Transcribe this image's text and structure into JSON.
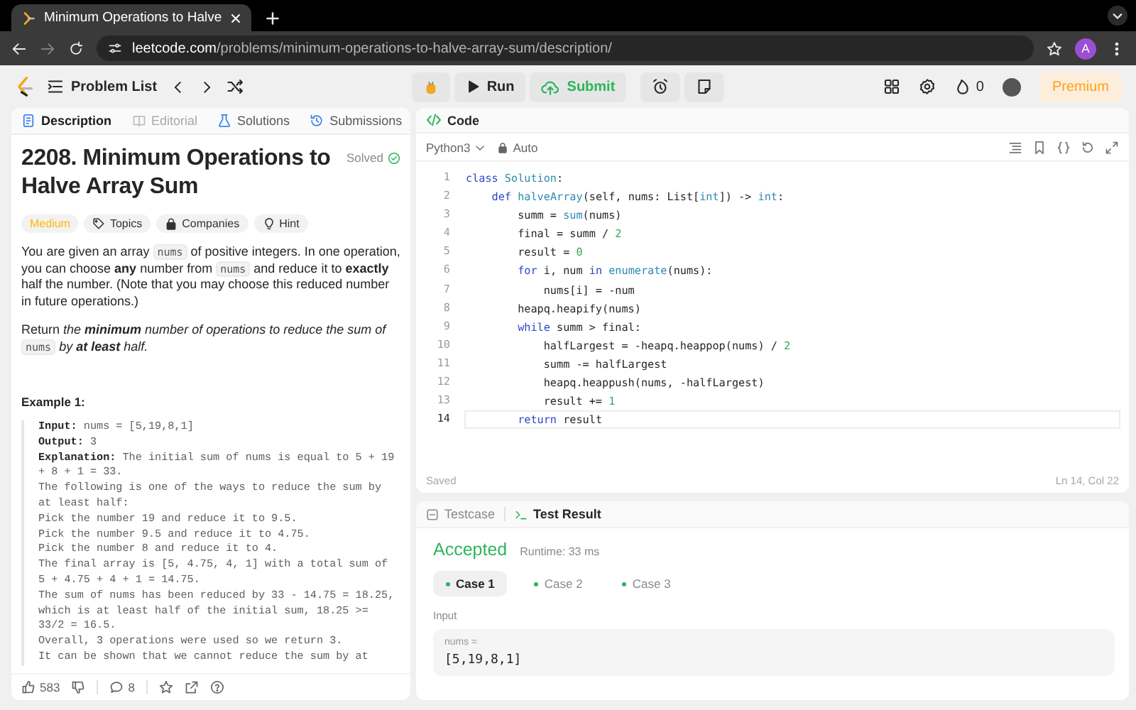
{
  "browser": {
    "tab_title": "Minimum Operations to Halve",
    "url_host": "leetcode.com",
    "url_path": "/problems/minimum-operations-to-halve-array-sum/description/",
    "profile": "A"
  },
  "topbar": {
    "problem_list": "Problem List",
    "run": "Run",
    "submit": "Submit",
    "streak": "0",
    "premium": "Premium"
  },
  "description_tabs": [
    {
      "label": "Description",
      "selected": true,
      "disabled": false
    },
    {
      "label": "Editorial",
      "selected": false,
      "disabled": true
    },
    {
      "label": "Solutions",
      "selected": false,
      "disabled": false
    },
    {
      "label": "Submissions",
      "selected": false,
      "disabled": false
    }
  ],
  "problem": {
    "title": "2208. Minimum Operations to Halve Array Sum",
    "status": "Solved",
    "tags": [
      {
        "label": "Medium",
        "kind": "difficulty"
      },
      {
        "label": "Topics",
        "kind": "topics"
      },
      {
        "label": "Companies",
        "kind": "companies"
      },
      {
        "label": "Hint",
        "kind": "hint"
      }
    ],
    "paragraphs": [
      [
        {
          "text": "You are given an array ",
          "kind": "text"
        },
        {
          "text": "nums",
          "kind": "code"
        },
        {
          "text": " of positive integers. In one operation, you can choose **any** number from ",
          "kind": "text"
        },
        {
          "text": "nums",
          "kind": "code"
        },
        {
          "text": " and reduce it to **exactly** half the number. (Note that you may choose this reduced number in future operations.)",
          "kind": "text"
        }
      ],
      [
        {
          "text": "Return ",
          "kind": "text"
        },
        {
          "text": "the **minimum** number of operations to reduce the sum of ",
          "kind": "em"
        },
        {
          "text": "nums",
          "kind": "code"
        },
        {
          "text": " by **at least** half.",
          "kind": "em"
        }
      ]
    ],
    "example_title": "Example 1:",
    "example_lines": [
      "**Input:** nums = [5,19,8,1]",
      "**Output:** 3",
      "**Explanation:** The initial sum of nums is equal to 5 + 19 + 8 + 1 = 33.",
      "The following is one of the ways to reduce the sum by at least half:",
      "Pick the number 19 and reduce it to 9.5.",
      "Pick the number 9.5 and reduce it to 4.75.",
      "Pick the number 8 and reduce it to 4.",
      "The final array is [5, 4.75, 4, 1] with a total sum of 5 + 4.75 + 4 + 1 = 14.75.",
      "The sum of nums has been reduced by 33 - 14.75 = 18.25, which is at least half of the initial sum, 18.25 >= 33/2 = 16.5.",
      "Overall, 3 operations were used so we return 3.",
      "It can be shown that we cannot reduce the sum by at"
    ]
  },
  "footer": {
    "likes": "583",
    "comments": "8"
  },
  "editor": {
    "title": "Code",
    "language": "Python3",
    "mode": "Auto",
    "status": "Saved",
    "cursor": "Ln 14, Col 22",
    "lines": [
      {
        "number": "1",
        "active": false,
        "segments": [
          {
            "text": "class",
            "kind": "keyword"
          },
          {
            "text": " Solution",
            "kind": "function"
          },
          {
            "text": ":",
            "kind": "plain"
          }
        ]
      },
      {
        "number": "2",
        "active": false,
        "segments": [
          {
            "text": "    def",
            "kind": "keyword"
          },
          {
            "text": " halveArray",
            "kind": "function"
          },
          {
            "text": "(self, nums: List[",
            "kind": "plain"
          },
          {
            "text": "int",
            "kind": "function"
          },
          {
            "text": "]) -> ",
            "kind": "plain"
          },
          {
            "text": "int",
            "kind": "function"
          },
          {
            "text": ":",
            "kind": "plain"
          }
        ]
      },
      {
        "number": "3",
        "active": false,
        "segments": [
          {
            "text": "        summ = ",
            "kind": "plain"
          },
          {
            "text": "sum",
            "kind": "function"
          },
          {
            "text": "(nums)",
            "kind": "plain"
          }
        ]
      },
      {
        "number": "4",
        "active": false,
        "segments": [
          {
            "text": "        final = summ / ",
            "kind": "plain"
          },
          {
            "text": "2",
            "kind": "number"
          }
        ]
      },
      {
        "number": "5",
        "active": false,
        "segments": [
          {
            "text": "        result = ",
            "kind": "plain"
          },
          {
            "text": "0",
            "kind": "number"
          }
        ]
      },
      {
        "number": "6",
        "active": false,
        "segments": [
          {
            "text": "        for",
            "kind": "keyword"
          },
          {
            "text": " i, num ",
            "kind": "plain"
          },
          {
            "text": "in",
            "kind": "keyword"
          },
          {
            "text": " enumerate",
            "kind": "function"
          },
          {
            "text": "(nums):",
            "kind": "plain"
          }
        ]
      },
      {
        "number": "7",
        "active": false,
        "segments": [
          {
            "text": "            nums[i] = -num",
            "kind": "plain"
          }
        ]
      },
      {
        "number": "8",
        "active": false,
        "segments": [
          {
            "text": "        heapq.heapify(nums)",
            "kind": "plain"
          }
        ]
      },
      {
        "number": "9",
        "active": false,
        "segments": [
          {
            "text": "        while",
            "kind": "keyword"
          },
          {
            "text": " summ > final:",
            "kind": "plain"
          }
        ]
      },
      {
        "number": "10",
        "active": false,
        "segments": [
          {
            "text": "            halfLargest = -heapq.heappop(nums) / ",
            "kind": "plain"
          },
          {
            "text": "2",
            "kind": "number"
          }
        ]
      },
      {
        "number": "11",
        "active": false,
        "segments": [
          {
            "text": "            summ -= halfLargest",
            "kind": "plain"
          }
        ]
      },
      {
        "number": "12",
        "active": false,
        "segments": [
          {
            "text": "            heapq.heappush(nums, -halfLargest)",
            "kind": "plain"
          }
        ]
      },
      {
        "number": "13",
        "active": false,
        "segments": [
          {
            "text": "            result += ",
            "kind": "plain"
          },
          {
            "text": "1",
            "kind": "number"
          }
        ]
      },
      {
        "number": "14",
        "active": true,
        "segments": [
          {
            "text": "        return",
            "kind": "keyword"
          },
          {
            "text": " result",
            "kind": "plain"
          }
        ]
      }
    ]
  },
  "console": {
    "tabs": [
      {
        "label": "Testcase",
        "selected": false
      },
      {
        "label": "Test Result",
        "selected": true
      }
    ],
    "verdict": "Accepted",
    "runtime": "Runtime: 33 ms",
    "cases": [
      {
        "label": "Case 1",
        "selected": true,
        "passed": true
      },
      {
        "label": "Case 2",
        "selected": false,
        "passed": true
      },
      {
        "label": "Case 3",
        "selected": false,
        "passed": true
      }
    ],
    "input_label": "Input",
    "param_name": "nums =",
    "param_value": "[5,19,8,1]"
  }
}
